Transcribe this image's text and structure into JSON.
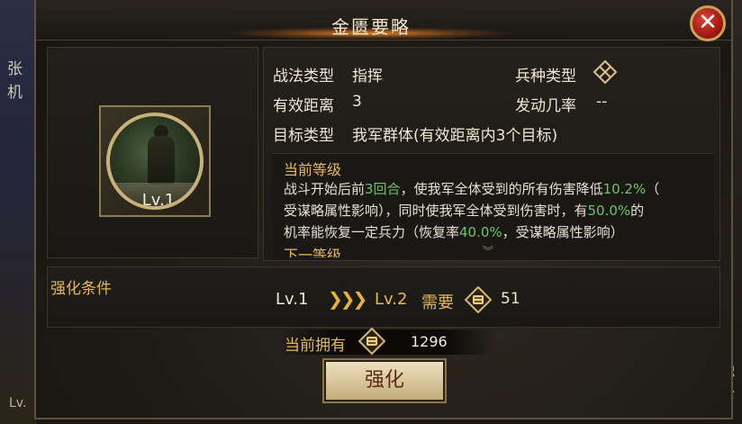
{
  "background": {
    "left_text_1": "张",
    "left_text_2": "机",
    "left_bottom": "Lv.",
    "right_text_1": "触",
    "right_text_2": "去"
  },
  "title": "金匮要略",
  "tactic": {
    "level_badge": "Lv.1",
    "type_label": "战法类型",
    "type_value": "指挥",
    "troop_label": "兵种类型",
    "range_label": "有效距离",
    "range_value": "3",
    "chance_label": "发动几率",
    "chance_value": "--",
    "target_label": "目标类型",
    "target_value": "我军群体(有效距离内3个目标)"
  },
  "description": {
    "current_level_label": "当前等级",
    "line1_a": "战斗开始后前",
    "line1_b": "3回合",
    "line1_c": "，使我军全体受到的所有伤害降低",
    "line1_d": "10.2%",
    "line1_e": "（",
    "line2_a": "受谋略属性影响），同时使我军全体受到伤害时，有",
    "line2_b": "50.0%",
    "line2_c": "的",
    "line3_a": "机率能恢复一定兵力（恢复率",
    "line3_b": "40.0%",
    "line3_c": "，受谋略属性影响）",
    "next_level_label": "下一等级"
  },
  "upgrade_condition": {
    "title": "强化条件",
    "from_level": "Lv.1",
    "to_level": "Lv.2",
    "need_label": "需要",
    "cost": "51"
  },
  "owned": {
    "label": "当前拥有",
    "value": "1296"
  },
  "upgrade_button": "强化",
  "close_label": "✕"
}
